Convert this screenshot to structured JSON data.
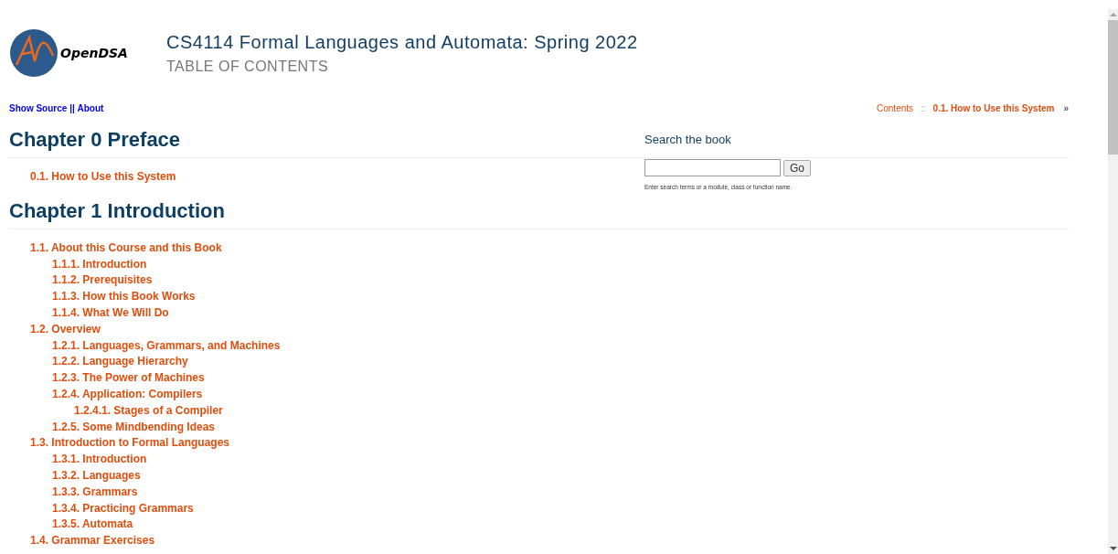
{
  "header": {
    "logo_text": "OpenDSA",
    "title": "CS4114 Formal Languages and Automata: Spring 2022",
    "subtitle": "TABLE OF CONTENTS"
  },
  "top_links": [
    "Show Source",
    "About"
  ],
  "top_links_separator": "||",
  "breadcrumb": {
    "contents": "Contents",
    "separator": "::",
    "current": "0.1. How to Use this System",
    "next": "»"
  },
  "search": {
    "heading": "Search the book",
    "button": "Go",
    "hint": "Enter search terms or a module, class or function name."
  },
  "chapters": [
    {
      "title": "Chapter 0 Preface",
      "children": [
        {
          "label": "0.1. How to Use this System"
        }
      ]
    },
    {
      "title": "Chapter 1 Introduction",
      "children": [
        {
          "label": "1.1. About this Course and this Book",
          "children": [
            {
              "label": "1.1.1. Introduction"
            },
            {
              "label": "1.1.2. Prerequisites"
            },
            {
              "label": "1.1.3. How this Book Works"
            },
            {
              "label": "1.1.4. What We Will Do"
            }
          ]
        },
        {
          "label": "1.2. Overview",
          "children": [
            {
              "label": "1.2.1. Languages, Grammars, and Machines"
            },
            {
              "label": "1.2.2. Language Hierarchy"
            },
            {
              "label": "1.2.3. The Power of Machines"
            },
            {
              "label": "1.2.4. Application: Compilers",
              "children": [
                {
                  "label": "1.2.4.1. Stages of a Compiler"
                }
              ]
            },
            {
              "label": "1.2.5. Some Mindbending Ideas"
            }
          ]
        },
        {
          "label": "1.3. Introduction to Formal Languages",
          "children": [
            {
              "label": "1.3.1. Introduction"
            },
            {
              "label": "1.3.2. Languages"
            },
            {
              "label": "1.3.3. Grammars"
            },
            {
              "label": "1.3.4. Practicing Grammars"
            },
            {
              "label": "1.3.5. Automata"
            }
          ]
        },
        {
          "label": "1.4. Grammar Exercises"
        }
      ]
    }
  ]
}
